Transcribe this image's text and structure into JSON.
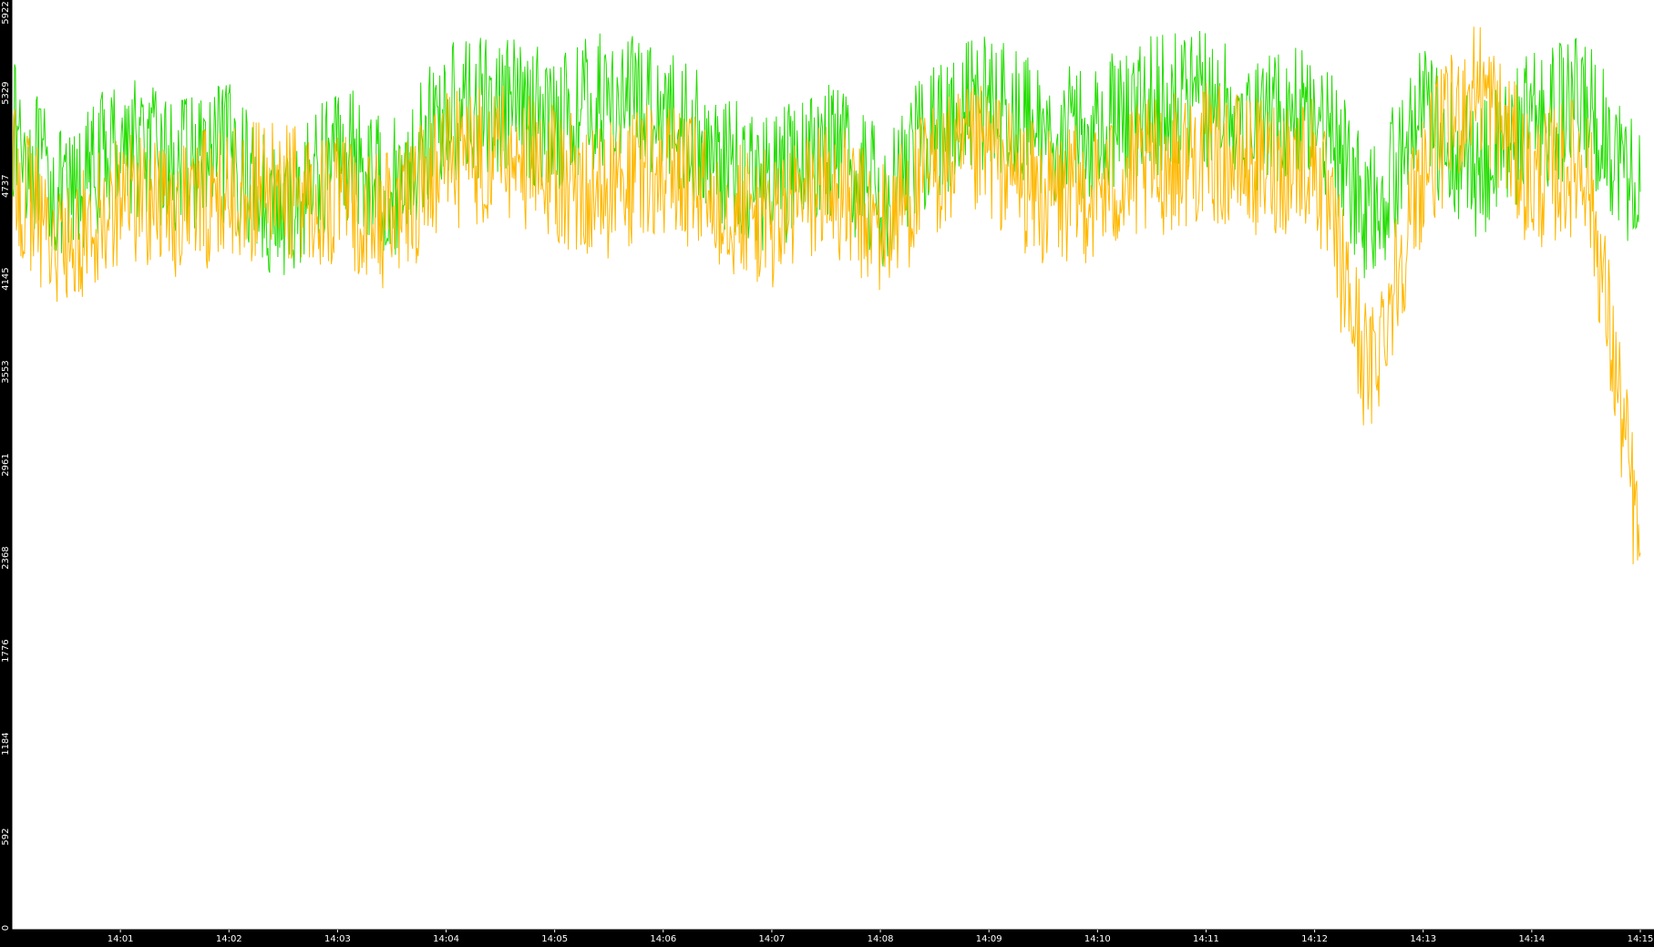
{
  "chart_data": {
    "type": "line",
    "title": "",
    "xlabel": "",
    "ylabel": "",
    "ylim": [
      0,
      5922
    ],
    "yticks": [
      0,
      592,
      1184,
      1776,
      2368,
      2961,
      3553,
      4145,
      4737,
      5329,
      5922
    ],
    "ytick_labels": [
      "0",
      "592",
      "1184",
      "1776",
      "2368",
      "2961",
      "3553",
      "4145",
      "4737",
      "5329",
      "5922"
    ],
    "xlim": [
      "14:00:00",
      "14:15:00"
    ],
    "xticks": [
      "14:01",
      "14:02",
      "14:03",
      "14:04",
      "14:05",
      "14:06",
      "14:07",
      "14:08",
      "14:09",
      "14:10",
      "14:11",
      "14:12",
      "14:13",
      "14:14",
      "14:15"
    ],
    "xtick_labels": [
      "14:01",
      "14:02",
      "14:03",
      "14:04",
      "14:05",
      "14:06",
      "14:07",
      "14:08",
      "14:09",
      "14:10",
      "14:11",
      "14:12",
      "14:13",
      "14:14",
      "14:15"
    ],
    "grid": false,
    "legend": false,
    "background": "#000000",
    "plot_background": "#ffffff",
    "series": [
      {
        "color": "#22dd00",
        "x": [
          "14:00:00",
          "14:00:30",
          "14:01:00",
          "14:01:30",
          "14:02:00",
          "14:02:30",
          "14:03:00",
          "14:03:30",
          "14:04:00",
          "14:04:30",
          "14:05:00",
          "14:05:30",
          "14:06:00",
          "14:06:30",
          "14:07:00",
          "14:07:30",
          "14:08:00",
          "14:08:30",
          "14:09:00",
          "14:09:30",
          "14:10:00",
          "14:10:30",
          "14:11:00",
          "14:11:30",
          "14:12:00",
          "14:12:30",
          "14:13:00",
          "14:13:30",
          "14:14:00",
          "14:14:30",
          "14:15:00"
        ],
        "values": [
          5100,
          4600,
          5050,
          4850,
          4950,
          4500,
          5000,
          4700,
          5200,
          5250,
          5150,
          5300,
          5250,
          4900,
          4750,
          5000,
          4650,
          5100,
          5300,
          5050,
          5100,
          5250,
          5300,
          5150,
          5250,
          4500,
          5200,
          4800,
          5150,
          5250,
          4700
        ]
      },
      {
        "color": "#ffb800",
        "x": [
          "14:00:00",
          "14:00:30",
          "14:01:00",
          "14:01:30",
          "14:02:00",
          "14:02:30",
          "14:03:00",
          "14:03:30",
          "14:04:00",
          "14:04:30",
          "14:05:00",
          "14:05:30",
          "14:06:00",
          "14:06:30",
          "14:07:00",
          "14:07:30",
          "14:08:00",
          "14:08:30",
          "14:09:00",
          "14:09:30",
          "14:10:00",
          "14:10:30",
          "14:11:00",
          "14:11:30",
          "14:12:00",
          "14:12:30",
          "14:13:00",
          "14:13:30",
          "14:14:00",
          "14:14:30",
          "14:15:00"
        ],
        "values": [
          4800,
          4300,
          4700,
          4600,
          4700,
          4700,
          4650,
          4500,
          4900,
          4950,
          4800,
          4700,
          4850,
          4650,
          4500,
          4750,
          4450,
          4850,
          4950,
          4650,
          4700,
          4850,
          4950,
          4850,
          4900,
          3500,
          4850,
          5400,
          4750,
          4900,
          2400
        ]
      }
    ]
  }
}
